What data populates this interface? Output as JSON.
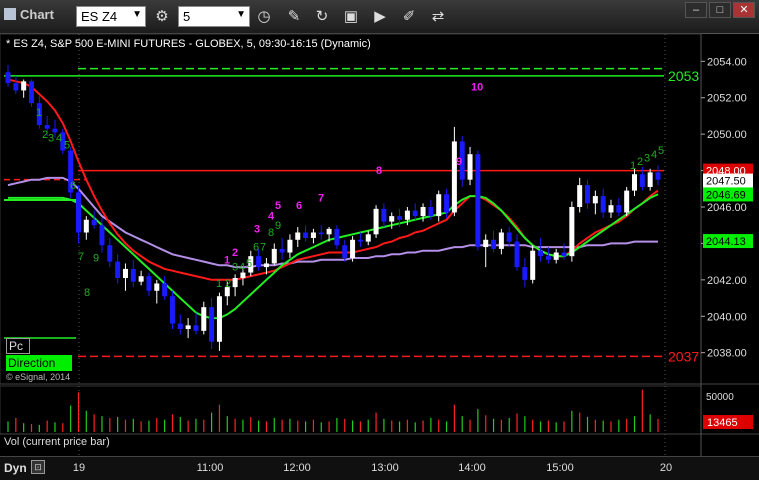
{
  "app": {
    "title": "Chart",
    "symbol": "ES Z4",
    "interval": "5"
  },
  "toolbar_icons": [
    "settings-icon",
    "clock-icon",
    "pencil-icon",
    "redo-icon",
    "studies-icon",
    "play-icon",
    "marker-icon",
    "link-icon"
  ],
  "chart_title": "* ES Z4, S&P 500 E-MINI FUTURES - GLOBEX, 5, 09:30-16:15 (Dynamic)",
  "copyright": "© eSignal, 2014",
  "legend": {
    "pc": "Pc",
    "direction": "Direction"
  },
  "volume_panel": {
    "label": "Vol (current price bar)",
    "ticks": [
      "50000",
      "10000"
    ],
    "current": "13465"
  },
  "bottom_bar": {
    "dyn": "Dyn",
    "times": [
      "19",
      "11:00",
      "12:00",
      "13:00",
      "14:00",
      "15:00",
      "20"
    ]
  },
  "price_axis": {
    "ticks": [
      "2054.00",
      "2052.00",
      "2050.00",
      "2048.00",
      "2046.00",
      "2044.00",
      "2042.00",
      "2040.00",
      "2038.00"
    ]
  },
  "price_tags": {
    "last": "2048.00",
    "current": "2047.50",
    "green": "2046.69",
    "ma": "2044.13"
  },
  "level_labels": {
    "upper": "2053",
    "lower": "2037"
  },
  "colors": {
    "up": "#ffffff",
    "down": "#1a1aff",
    "red_line": "#ff1a1a",
    "green_line": "#22ee22",
    "purple_line": "#b48fe8",
    "magenta_count": "#ee22ee",
    "green_count": "#22aa22"
  },
  "chart_data": {
    "type": "candlestick",
    "ylim": [
      2036.5,
      2055.5
    ],
    "levels": [
      2053.2,
      2037.8,
      2048.0
    ],
    "dashed_upper": 2053.6,
    "red_dash": 2047.5,
    "candles": [
      [
        2053.4,
        2053.8,
        2052.6,
        2052.8
      ],
      [
        2052.8,
        2053.2,
        2052.2,
        2052.4
      ],
      [
        2052.4,
        2053.0,
        2052.0,
        2052.9
      ],
      [
        2052.9,
        2053.0,
        2051.5,
        2051.7
      ],
      [
        2051.7,
        2052.1,
        2050.3,
        2050.5
      ],
      [
        2050.5,
        2051.0,
        2049.9,
        2050.3
      ],
      [
        2050.3,
        2050.8,
        2049.8,
        2050.1
      ],
      [
        2050.1,
        2050.3,
        2048.9,
        2049.1
      ],
      [
        2049.1,
        2049.3,
        2046.5,
        2046.8
      ],
      [
        2046.8,
        2047.2,
        2044.0,
        2044.6
      ],
      [
        2044.6,
        2045.5,
        2044.2,
        2045.3
      ],
      [
        2045.3,
        2045.8,
        2044.8,
        2045.0
      ],
      [
        2045.0,
        2045.4,
        2043.5,
        2043.9
      ],
      [
        2043.9,
        2044.3,
        2042.7,
        2043.0
      ],
      [
        2043.0,
        2043.4,
        2041.8,
        2042.1
      ],
      [
        2042.1,
        2042.9,
        2041.4,
        2042.6
      ],
      [
        2042.6,
        2043.1,
        2041.6,
        2041.9
      ],
      [
        2041.9,
        2042.5,
        2041.7,
        2042.2
      ],
      [
        2042.2,
        2042.4,
        2041.1,
        2041.4
      ],
      [
        2041.4,
        2042.0,
        2040.7,
        2041.8
      ],
      [
        2041.8,
        2042.2,
        2040.9,
        2041.1
      ],
      [
        2041.1,
        2041.4,
        2039.3,
        2039.6
      ],
      [
        2039.6,
        2040.1,
        2039.0,
        2039.3
      ],
      [
        2039.3,
        2039.9,
        2038.8,
        2039.5
      ],
      [
        2039.5,
        2040.2,
        2039.0,
        2039.2
      ],
      [
        2039.2,
        2040.8,
        2039.0,
        2040.5
      ],
      [
        2040.5,
        2041.0,
        2038.2,
        2038.6
      ],
      [
        2038.6,
        2041.3,
        2038.1,
        2041.1
      ],
      [
        2041.1,
        2041.9,
        2040.6,
        2041.6
      ],
      [
        2041.6,
        2042.3,
        2041.1,
        2042.1
      ],
      [
        2042.1,
        2042.7,
        2041.7,
        2042.4
      ],
      [
        2042.4,
        2043.6,
        2042.2,
        2043.3
      ],
      [
        2043.3,
        2043.7,
        2042.5,
        2042.7
      ],
      [
        2042.7,
        2043.2,
        2042.3,
        2042.9
      ],
      [
        2042.9,
        2044.0,
        2042.8,
        2043.7
      ],
      [
        2043.7,
        2044.3,
        2043.1,
        2043.5
      ],
      [
        2043.5,
        2044.5,
        2043.2,
        2044.2
      ],
      [
        2044.2,
        2044.9,
        2043.8,
        2044.6
      ],
      [
        2044.6,
        2045.0,
        2044.1,
        2044.3
      ],
      [
        2044.3,
        2044.8,
        2044.0,
        2044.6
      ],
      [
        2044.6,
        2045.0,
        2044.2,
        2044.5
      ],
      [
        2044.5,
        2044.9,
        2044.1,
        2044.8
      ],
      [
        2044.8,
        2045.0,
        2043.7,
        2043.9
      ],
      [
        2043.9,
        2044.2,
        2043.0,
        2043.2
      ],
      [
        2043.2,
        2044.4,
        2043.0,
        2044.2
      ],
      [
        2044.2,
        2044.6,
        2043.8,
        2044.1
      ],
      [
        2044.1,
        2044.7,
        2043.9,
        2044.5
      ],
      [
        2044.5,
        2046.1,
        2044.3,
        2045.9
      ],
      [
        2045.9,
        2046.2,
        2044.9,
        2045.2
      ],
      [
        2045.2,
        2045.7,
        2044.8,
        2045.5
      ],
      [
        2045.5,
        2045.9,
        2044.9,
        2045.3
      ],
      [
        2045.3,
        2046.0,
        2045.0,
        2045.8
      ],
      [
        2045.8,
        2046.2,
        2045.3,
        2045.5
      ],
      [
        2045.5,
        2046.2,
        2045.2,
        2046.0
      ],
      [
        2046.0,
        2046.4,
        2045.3,
        2045.5
      ],
      [
        2045.5,
        2046.9,
        2045.2,
        2046.7
      ],
      [
        2046.7,
        2047.0,
        2045.4,
        2045.7
      ],
      [
        2045.7,
        2050.4,
        2045.5,
        2049.6
      ],
      [
        2049.6,
        2049.9,
        2047.1,
        2047.5
      ],
      [
        2047.5,
        2049.3,
        2047.2,
        2048.9
      ],
      [
        2048.9,
        2049.1,
        2043.6,
        2043.8
      ],
      [
        2043.8,
        2044.5,
        2042.7,
        2044.2
      ],
      [
        2044.2,
        2044.7,
        2043.5,
        2043.7
      ],
      [
        2043.7,
        2044.8,
        2043.4,
        2044.6
      ],
      [
        2044.6,
        2044.9,
        2043.8,
        2044.1
      ],
      [
        2044.1,
        2044.5,
        2042.5,
        2042.7
      ],
      [
        2042.7,
        2043.2,
        2041.6,
        2042.0
      ],
      [
        2042.0,
        2043.9,
        2041.8,
        2043.6
      ],
      [
        2043.6,
        2044.3,
        2043.0,
        2043.3
      ],
      [
        2043.3,
        2043.8,
        2042.9,
        2043.1
      ],
      [
        2043.1,
        2043.7,
        2042.9,
        2043.5
      ],
      [
        2043.5,
        2044.0,
        2043.1,
        2043.3
      ],
      [
        2043.3,
        2046.3,
        2043.0,
        2046.0
      ],
      [
        2046.0,
        2047.6,
        2045.7,
        2047.2
      ],
      [
        2047.2,
        2047.5,
        2045.9,
        2046.2
      ],
      [
        2046.2,
        2046.9,
        2045.6,
        2046.6
      ],
      [
        2046.6,
        2047.0,
        2045.4,
        2045.7
      ],
      [
        2045.7,
        2046.4,
        2045.4,
        2046.1
      ],
      [
        2046.1,
        2046.5,
        2045.5,
        2045.7
      ],
      [
        2045.7,
        2047.1,
        2045.5,
        2046.9
      ],
      [
        2046.9,
        2048.1,
        2046.6,
        2047.8
      ],
      [
        2047.8,
        2048.2,
        2046.9,
        2047.1
      ],
      [
        2047.1,
        2048.1,
        2046.9,
        2047.9
      ],
      [
        2047.9,
        2048.3,
        2047.2,
        2047.5
      ]
    ],
    "red_ma": [
      2053.0,
      2052.9,
      2052.8,
      2052.6,
      2052.2,
      2051.8,
      2051.3,
      2050.6,
      2049.6,
      2048.5,
      2047.5,
      2046.6,
      2045.8,
      2045.1,
      2044.5,
      2044.0,
      2043.6,
      2043.3,
      2043.0,
      2042.8,
      2042.6,
      2042.5,
      2042.4,
      2042.3,
      2042.2,
      2042.1,
      2042.0,
      2042.0,
      2042.0,
      2042.0,
      2042.1,
      2042.2,
      2042.3,
      2042.4,
      2042.5,
      2042.7,
      2042.9,
      2043.1,
      2043.2,
      2043.3,
      2043.4,
      2043.5,
      2043.5,
      2043.5,
      2043.5,
      2043.6,
      2043.7,
      2043.8,
      2044.0,
      2044.1,
      2044.3,
      2044.4,
      2044.6,
      2044.7,
      2044.9,
      2045.1,
      2045.3,
      2045.8,
      2046.2,
      2046.6,
      2046.6,
      2046.4,
      2046.1,
      2045.8,
      2045.4,
      2044.9,
      2044.3,
      2043.9,
      2043.6,
      2043.4,
      2043.3,
      2043.3,
      2043.6,
      2044.0,
      2044.3,
      2044.6,
      2044.8,
      2045.0,
      2045.2,
      2045.5,
      2045.9,
      2046.2,
      2046.6,
      2046.9
    ],
    "green_ma": [
      2046.5,
      2046.5,
      2046.5,
      2046.5,
      2046.5,
      2046.5,
      2046.5,
      2046.5,
      2046.4,
      2046.2,
      2045.8,
      2045.4,
      2045.0,
      2044.6,
      2044.2,
      2043.8,
      2043.4,
      2043.0,
      2042.6,
      2042.2,
      2041.8,
      2041.4,
      2041.0,
      2040.6,
      2040.2,
      2040.0,
      2039.9,
      2039.9,
      2040.1,
      2040.4,
      2040.8,
      2041.2,
      2041.6,
      2042.0,
      2042.4,
      2042.8,
      2043.1,
      2043.4,
      2043.6,
      2043.8,
      2044.0,
      2044.2,
      2044.3,
      2044.4,
      2044.5,
      2044.6,
      2044.7,
      2044.8,
      2044.9,
      2045.0,
      2045.1,
      2045.2,
      2045.3,
      2045.4,
      2045.5,
      2045.6,
      2045.7,
      2046.1,
      2046.4,
      2046.6,
      2046.6,
      2046.5,
      2046.2,
      2045.8,
      2045.3,
      2044.8,
      2044.3,
      2043.9,
      2043.6,
      2043.4,
      2043.3,
      2043.3,
      2043.5,
      2043.8,
      2044.1,
      2044.4,
      2044.7,
      2045.0,
      2045.3,
      2045.6,
      2045.9,
      2046.2,
      2046.5,
      2046.7
    ],
    "purple_ma": [
      2047.2,
      2047.3,
      2047.4,
      2047.5,
      2047.5,
      2047.6,
      2047.6,
      2047.6,
      2047.4,
      2047.0,
      2046.5,
      2046.0,
      2045.5,
      2045.2,
      2044.9,
      2044.6,
      2044.4,
      2044.2,
      2044.0,
      2043.8,
      2043.6,
      2043.4,
      2043.3,
      2043.2,
      2043.1,
      2043.0,
      2042.9,
      2042.8,
      2042.8,
      2042.7,
      2042.7,
      2042.7,
      2042.8,
      2042.8,
      2042.8,
      2042.9,
      2042.9,
      2043.0,
      2043.0,
      2043.0,
      2043.1,
      2043.1,
      2043.1,
      2043.1,
      2043.2,
      2043.2,
      2043.2,
      2043.3,
      2043.3,
      2043.4,
      2043.4,
      2043.5,
      2043.5,
      2043.6,
      2043.6,
      2043.6,
      2043.7,
      2043.8,
      2043.8,
      2043.9,
      2043.9,
      2043.9,
      2043.9,
      2043.9,
      2043.9,
      2043.9,
      2043.9,
      2043.8,
      2043.8,
      2043.8,
      2043.8,
      2043.8,
      2043.8,
      2043.8,
      2043.9,
      2043.9,
      2043.9,
      2044.0,
      2044.0,
      2044.0,
      2044.1,
      2044.1,
      2044.1,
      2044.1
    ],
    "volume": [
      12,
      16,
      10,
      9,
      8,
      13,
      11,
      10,
      30,
      45,
      24,
      20,
      18,
      16,
      17,
      14,
      15,
      12,
      13,
      16,
      14,
      20,
      17,
      13,
      15,
      14,
      22,
      31,
      18,
      15,
      14,
      17,
      13,
      12,
      16,
      14,
      15,
      13,
      12,
      14,
      11,
      12,
      16,
      15,
      13,
      12,
      14,
      22,
      15,
      13,
      12,
      14,
      11,
      13,
      16,
      14,
      12,
      31,
      18,
      14,
      26,
      19,
      15,
      14,
      16,
      21,
      18,
      14,
      12,
      13,
      11,
      12,
      24,
      22,
      17,
      14,
      13,
      12,
      14,
      15,
      18,
      48,
      20,
      15
    ],
    "green_counts": [
      [
        "1",
        2051.0,
        36
      ],
      [
        "2",
        2049.8,
        42
      ],
      [
        "3",
        2049.6,
        48
      ],
      [
        "4",
        2049.6,
        56
      ],
      [
        "5",
        2049.2,
        64
      ],
      [
        "6",
        2047.0,
        70
      ],
      [
        "7",
        2043.1,
        78
      ],
      [
        "8",
        2041.1,
        84
      ],
      [
        "9",
        2043.0,
        93
      ],
      [
        "1",
        2041.6,
        216
      ],
      [
        "2",
        2041.6,
        225
      ],
      [
        "3",
        2042.5,
        232
      ],
      [
        "4",
        2042.5,
        239
      ],
      [
        "5",
        2042.7,
        246
      ],
      [
        "6",
        2043.6,
        253
      ],
      [
        "7",
        2043.6,
        260
      ],
      [
        "8",
        2044.4,
        268
      ],
      [
        "9",
        2044.8,
        275
      ],
      [
        "1",
        2048.1,
        630
      ],
      [
        "2",
        2048.3,
        637
      ],
      [
        "3",
        2048.5,
        644
      ],
      [
        "4",
        2048.7,
        651
      ],
      [
        "5",
        2048.9,
        658
      ]
    ],
    "magenta_counts": [
      [
        "1",
        2042.9,
        224
      ],
      [
        "2",
        2043.3,
        232
      ],
      [
        "3",
        2044.6,
        254
      ],
      [
        "4",
        2045.3,
        268
      ],
      [
        "5",
        2045.9,
        275
      ],
      [
        "6",
        2045.9,
        296
      ],
      [
        "7",
        2046.3,
        318
      ],
      [
        "8",
        2047.8,
        376
      ],
      [
        "9",
        2048.3,
        456
      ],
      [
        "10",
        2052.4,
        471
      ]
    ]
  }
}
